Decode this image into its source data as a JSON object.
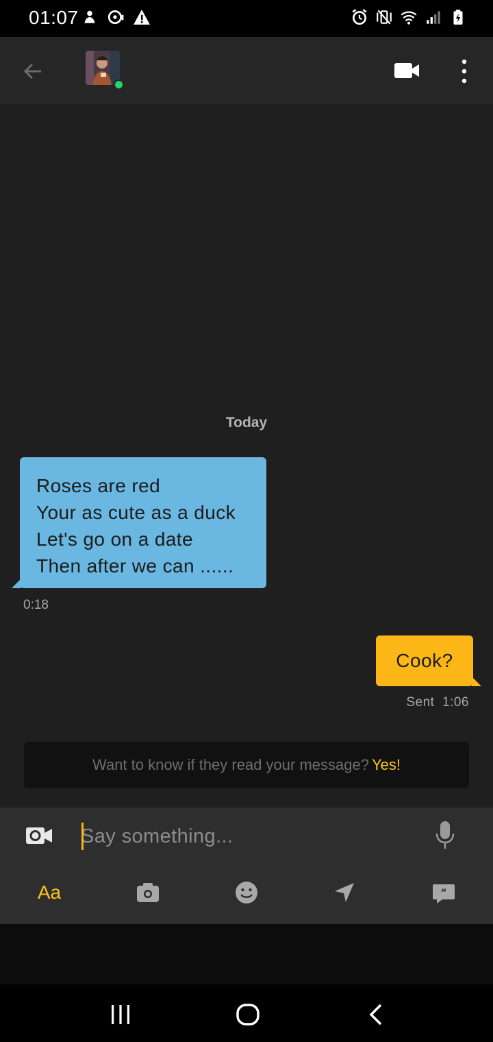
{
  "status_bar": {
    "time": "01:07",
    "icons_left": [
      "notification-icon",
      "chat-bubble-icon",
      "warning-icon"
    ],
    "icons_right": [
      "alarm-icon",
      "vibrate-mute-icon",
      "wifi-icon",
      "signal-icon",
      "battery-icon"
    ]
  },
  "app_bar": {
    "back_icon": "arrow-left-icon",
    "avatar_status": "online",
    "video_call_icon": "video-camera-icon",
    "more_icon": "more-vertical-icon"
  },
  "chat": {
    "date_separator": "Today",
    "messages": [
      {
        "direction": "incoming",
        "lines": [
          "Roses are red",
          "Your as cute as a duck",
          "Let's go on a date",
          "Then after we can ......"
        ],
        "time": "0:18"
      },
      {
        "direction": "outgoing",
        "text": "Cook?",
        "status_time": "Sent  1:06"
      }
    ],
    "read_receipt_banner": {
      "text": "Want to know if they read your message?",
      "action": "Yes!"
    }
  },
  "composer": {
    "placeholder": "Say something...",
    "left_icon": "video-camera-outline-icon",
    "right_icon": "microphone-icon",
    "toolbar": {
      "text_format_label": "Aa",
      "icons": [
        "camera-icon",
        "emoji-icon",
        "location-icon",
        "saved-phrases-icon"
      ]
    }
  },
  "colors": {
    "incoming_bubble": "#6ab8e1",
    "outgoing_bubble": "#fcb616",
    "accent": "#fcc419",
    "online": "#22d66b"
  }
}
